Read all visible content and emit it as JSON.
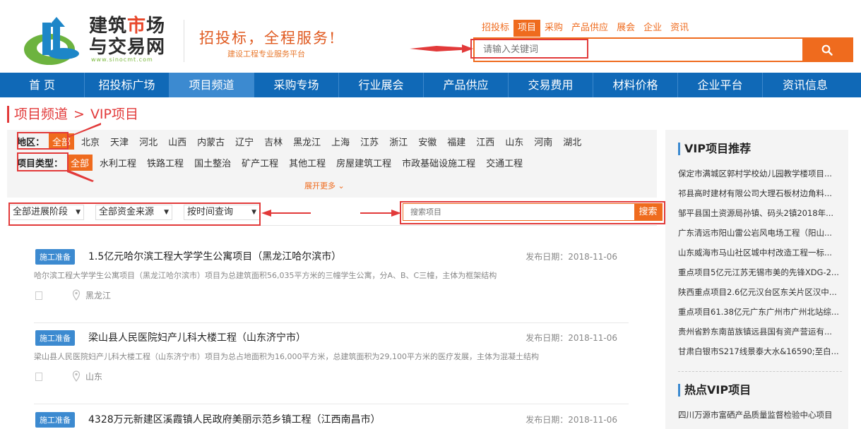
{
  "logo": {
    "line1_a": "建筑",
    "line1_b": "市",
    "line1_c": "场",
    "line2": "与交易网",
    "url": "www.sinocmt.com"
  },
  "slogan": {
    "main": "招投标，全程服务!",
    "sub": "建设工程专业服务平台"
  },
  "search": {
    "tabs": [
      "招投标",
      "项目",
      "采购",
      "产品供应",
      "展会",
      "企业",
      "资讯"
    ],
    "active_tab": "项目",
    "placeholder": "请输入关键词",
    "button_icon": "search-icon"
  },
  "nav": [
    "首 页",
    "招投标广场",
    "项目频道",
    "采购专场",
    "行业展会",
    "产品供应",
    "交易费用",
    "材料价格",
    "企业平台",
    "资讯信息"
  ],
  "nav_active": "项目频道",
  "breadcrumb": {
    "parent": "项目频道",
    "sep": ">",
    "current": "VIP项目"
  },
  "filter": {
    "region_label": "地区：",
    "regions": [
      "全部",
      "北京",
      "天津",
      "河北",
      "山西",
      "内蒙古",
      "辽宁",
      "吉林",
      "黑龙江",
      "上海",
      "江苏",
      "浙江",
      "安徽",
      "福建",
      "江西",
      "山东",
      "河南",
      "湖北"
    ],
    "type_label": "项目类型：",
    "types": [
      "全部",
      "水利工程",
      "铁路工程",
      "国土整治",
      "矿产工程",
      "其他工程",
      "房屋建筑工程",
      "市政基础设施工程",
      "交通工程"
    ],
    "expand": "展开更多"
  },
  "sortbar": {
    "stage": "全部进展阶段",
    "fund": "全部资金来源",
    "time": "按时间查询",
    "search_placeholder": "搜索项目",
    "search_btn": "搜索"
  },
  "projects": [
    {
      "badge": "施工准备",
      "title": "1.5亿元哈尔滨工程大学学生公寓项目（黑龙江哈尔滨市）",
      "date": "发布日期：2018-11-06",
      "desc": "哈尔滨工程大学学生公寓项目（黑龙江哈尔滨市）项目为总建筑面积56,035平方米的三幢学生公寓，分A、B、C三幢，主体为框架结构",
      "location": "黑龙江"
    },
    {
      "badge": "施工准备",
      "title": "梁山县人民医院妇产儿科大楼工程（山东济宁市）",
      "date": "发布日期：2018-11-06",
      "desc": "梁山县人民医院妇产儿科大楼工程（山东济宁市）项目为总占地面积为16,000平方米，总建筑面积为29,100平方米的医疗发展，主体为混凝土结构",
      "location": "山东"
    },
    {
      "badge": "施工准备",
      "title": "4328万元新建区溪霞镇人民政府美丽示范乡镇工程（江西南昌市）",
      "date": "发布日期：2018-11-06",
      "desc": "",
      "location": ""
    }
  ],
  "sidebar": {
    "vip_title": "VIP项目推荐",
    "vip_items": [
      "保定市满城区郭村学校幼儿园教学楼项目...",
      "祁县高时建材有限公司大理石板材边角料...",
      "邹平县国土资源局孙镇、码头2镇2018年...",
      "广东清远市阳山雷公岩风电场工程（阳山...",
      "山东威海市马山社区城中村改造工程一标...",
      "重点项目5亿元江苏无锡市美的先锋XDG-2...",
      "陕西重点项目2.6亿元汉台区东关片区汉中...",
      "重点项目61.38亿元广东广州市广州北站综...",
      "贵州省黔东南苗族镇远县国有资产营运有...",
      "甘肃白银市S217线景泰大水&16590;至白..."
    ],
    "hot_title": "热点VIP项目",
    "hot_items": [
      "四川万源市富硒产品质量监督检验中心项目"
    ]
  },
  "colors": {
    "accent": "#ef6b1e",
    "nav": "#1069b7",
    "nav_active": "#3c8ad0",
    "annotation": "#e23a3a"
  }
}
